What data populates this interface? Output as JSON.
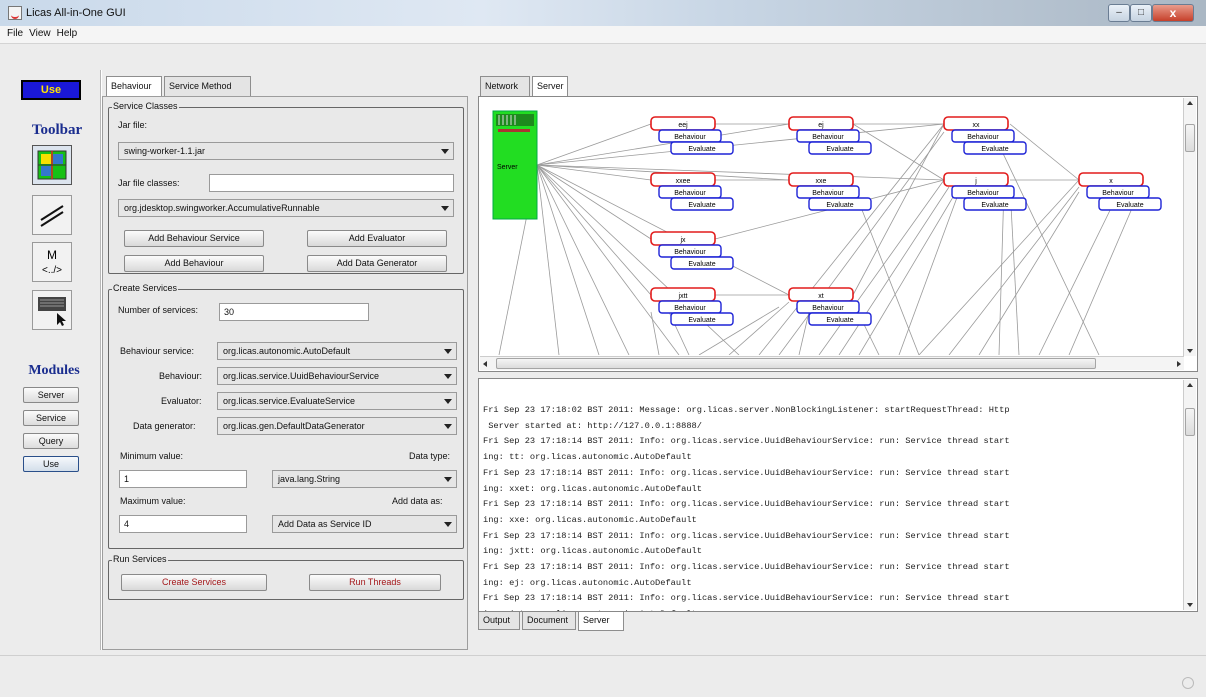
{
  "window": {
    "title": "Licas All-in-One GUI",
    "minimize": "–",
    "maximize": "□",
    "close": "x"
  },
  "menu": [
    "File",
    "View",
    "Help"
  ],
  "left": {
    "use_top": "Use",
    "toolbar_label": "Toolbar",
    "tools": [
      {
        "icon": "grid-layout-icon"
      },
      {
        "icon": "line-tool-icon"
      },
      {
        "icon": "markup-tag-icon",
        "text_top": "M",
        "text_bottom": "<../>"
      },
      {
        "icon": "pointer-panel-icon"
      }
    ],
    "modules_label": "Modules",
    "modules": [
      "Server",
      "Service",
      "Query",
      "Use"
    ]
  },
  "behaviour": {
    "tabs": [
      "Behaviour",
      "Service Method"
    ],
    "service_classes": {
      "title": "Service Classes",
      "jar_file_label": "Jar file:",
      "jar_file": "swing-worker-1.1.jar",
      "jar_classes_label": "Jar file classes:",
      "jar_classes_value": "",
      "class_select": "org.jdesktop.swingworker.AccumulativeRunnable",
      "buttons": [
        "Add Behaviour Service",
        "Add Evaluator",
        "Add Behaviour",
        "Add Data Generator"
      ]
    },
    "create_services": {
      "title": "Create Services",
      "num_label": "Number of services:",
      "num_value": "30",
      "behaviour_service_label": "Behaviour service:",
      "behaviour_service": "org.licas.autonomic.AutoDefault",
      "behaviour_label": "Behaviour:",
      "behaviour": "org.licas.service.UuidBehaviourService",
      "evaluator_label": "Evaluator:",
      "evaluator": "org.licas.service.EvaluateService",
      "datagen_label": "Data generator:",
      "datagen": "org.licas.gen.DefaultDataGenerator",
      "min_label": "Minimum value:",
      "min_value": "1",
      "datatype_label": "Data type:",
      "datatype": "java.lang.String",
      "max_label": "Maximum value:",
      "max_value": "4",
      "adddata_label": "Add data as:",
      "adddata": "Add Data as Service ID"
    },
    "run_services": {
      "title": "Run Services",
      "create_btn": "Create Services",
      "run_btn": "Run Threads"
    }
  },
  "right": {
    "tabs": [
      "Network",
      "Server"
    ],
    "graph": {
      "server_label": "Server",
      "node_behaviour": "Behaviour",
      "node_evaluate": "Evaluate",
      "nodes": [
        "eej",
        "ej",
        "xx",
        "xxee",
        "xxe",
        "j",
        "x",
        "jx",
        "jxtt",
        "xt"
      ]
    },
    "log": [
      "Fri Sep 23 17:18:02 BST 2011: Message: org.licas.server.NonBlockingListener: startRequestThread: Http",
      " Server started at: http://127.0.0.1:8888/",
      "Fri Sep 23 17:18:14 BST 2011: Info: org.licas.service.UuidBehaviourService: run: Service thread start",
      "ing: tt: org.licas.autonomic.AutoDefault",
      "Fri Sep 23 17:18:14 BST 2011: Info: org.licas.service.UuidBehaviourService: run: Service thread start",
      "ing: xxet: org.licas.autonomic.AutoDefault",
      "Fri Sep 23 17:18:14 BST 2011: Info: org.licas.service.UuidBehaviourService: run: Service thread start",
      "ing: xxe: org.licas.autonomic.AutoDefault",
      "Fri Sep 23 17:18:14 BST 2011: Info: org.licas.service.UuidBehaviourService: run: Service thread start",
      "ing: jxtt: org.licas.autonomic.AutoDefault",
      "Fri Sep 23 17:18:14 BST 2011: Info: org.licas.service.UuidBehaviourService: run: Service thread start",
      "ing: ej: org.licas.autonomic.AutoDefault",
      "Fri Sep 23 17:18:14 BST 2011: Info: org.licas.service.UuidBehaviourService: run: Service thread start",
      "ing: jet: org.licas.autonomic.AutoDefault"
    ],
    "bottom_tabs": [
      "Output",
      "Document",
      "Server"
    ]
  },
  "colors": {
    "use_bg": "#1a18d8",
    "use_fg": "#ffe400",
    "server_green": "#22dd22",
    "node_red": "#e21b1b",
    "node_blue": "#1d22d6"
  }
}
